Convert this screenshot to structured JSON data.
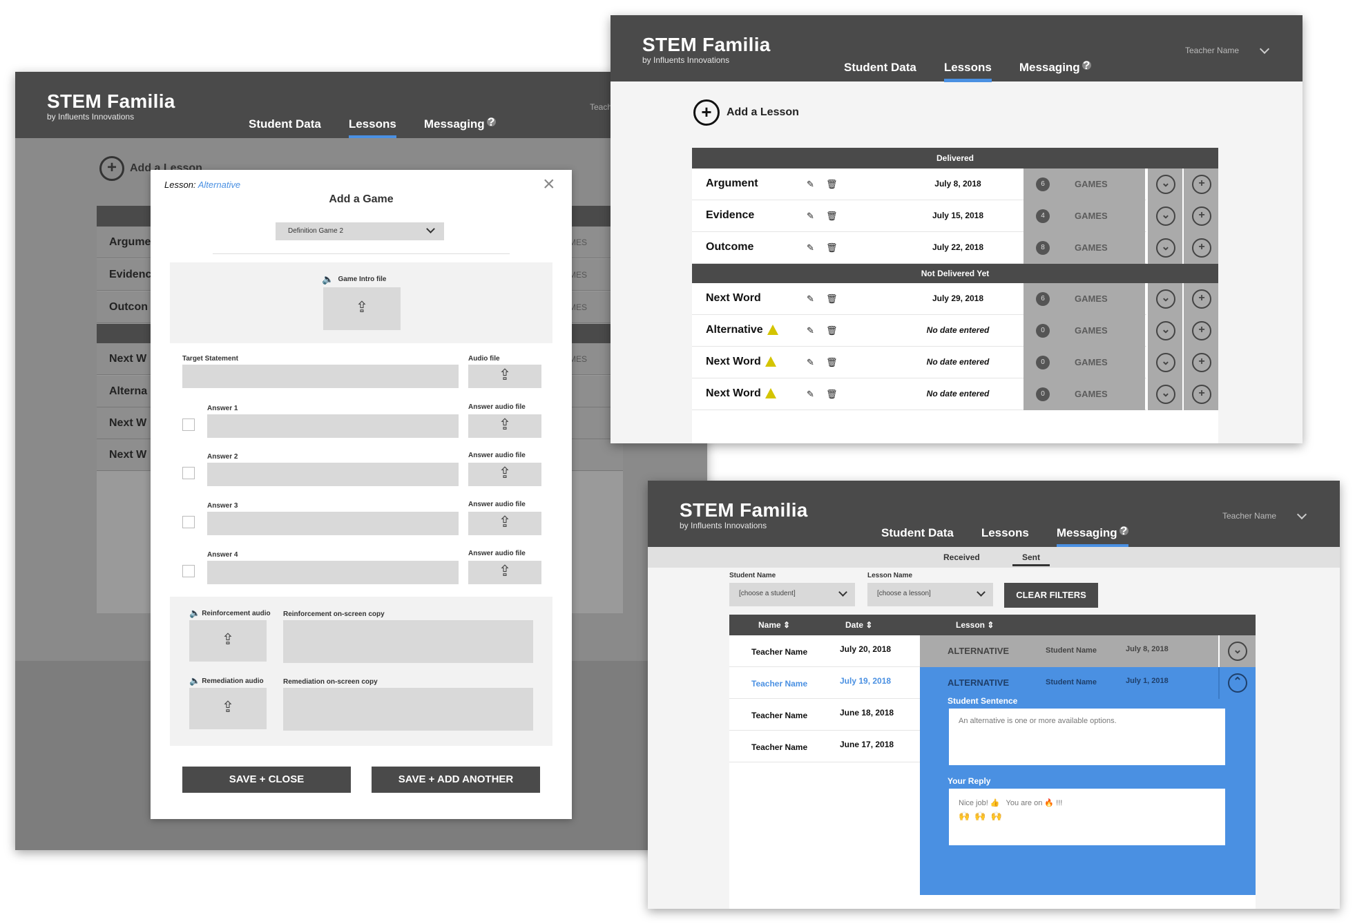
{
  "colors": {
    "header": "#4a4a4a",
    "accent": "#4a90e2",
    "warning": "#d4c400",
    "panel": "#aaaaaa"
  },
  "app": {
    "title": "STEM Familia",
    "subtitle": "by Influents Innovations",
    "teacher": "Teacher Name",
    "teacher_short": "Teach"
  },
  "nav": {
    "student_data": "Student Data",
    "lessons": "Lessons",
    "messaging": "Messaging",
    "help": "?"
  },
  "lessons_screen": {
    "add_lesson": "Add a Lesson",
    "sections": {
      "delivered": "Delivered",
      "not_delivered": "Not Delivered Yet"
    },
    "games_label": "GAMES",
    "delivered": [
      {
        "name": "Argument",
        "date": "July 8, 2018",
        "games": "6"
      },
      {
        "name": "Evidence",
        "date": "July 15, 2018",
        "games": "4"
      },
      {
        "name": "Outcome",
        "date": "July 22, 2018",
        "games": "8"
      }
    ],
    "not_delivered": [
      {
        "name": "Next Word",
        "date": "July 29, 2018",
        "games": "6"
      },
      {
        "name": "Alternative",
        "date": "No date entered",
        "games": "0"
      },
      {
        "name": "Next Word",
        "date": "No date entered",
        "games": "0"
      },
      {
        "name": "Next Word",
        "date": "No date entered",
        "games": "0"
      }
    ]
  },
  "background_screen": {
    "add_lesson": "Add a Lesson",
    "rows": [
      "Argume",
      "Evidenc",
      "Outcon",
      "Next W",
      "Alterna",
      "Next W",
      "Next W"
    ],
    "games_partial": "AMES"
  },
  "modal": {
    "lesson_label": "Lesson:",
    "lesson_name": "Alternative",
    "title": "Add a Game",
    "game_select": "Definition Game 2",
    "game_intro": "Game Intro file",
    "target_statement": "Target Statement",
    "audio_file": "Audio file",
    "answers": [
      {
        "label": "Answer 1",
        "audio": "Answer audio file"
      },
      {
        "label": "Answer 2",
        "audio": "Answer audio file"
      },
      {
        "label": "Answer 3",
        "audio": "Answer audio file"
      },
      {
        "label": "Answer 4",
        "audio": "Answer audio file"
      }
    ],
    "reinforcement_audio": "Reinforcement audio",
    "reinforcement_copy": "Reinforcement on-screen copy",
    "remediation_audio": "Remediation audio",
    "remediation_copy": "Remediation on-screen copy",
    "save_close": "SAVE + CLOSE",
    "save_add": "SAVE + ADD ANOTHER",
    "close": "×"
  },
  "messaging_screen": {
    "tabs": {
      "received": "Received",
      "sent": "Sent"
    },
    "filters": {
      "student_label": "Student Name",
      "student_placeholder": "[choose a student]",
      "lesson_label": "Lesson Name",
      "lesson_placeholder": "[choose a lesson]",
      "clear": "CLEAR FILTERS"
    },
    "columns": {
      "name": "Name",
      "date": "Date",
      "lesson": "Lesson"
    },
    "rows": [
      {
        "name": "Teacher Name",
        "date": "July 20, 2018"
      },
      {
        "name": "Teacher Name",
        "date": "July 19, 2018"
      },
      {
        "name": "Teacher Name",
        "date": "June 18, 2018"
      },
      {
        "name": "Teacher Name",
        "date": "June 17, 2018"
      }
    ],
    "detail": [
      {
        "lesson": "ALTERNATIVE",
        "student": "Student Name",
        "date": "July 8, 2018"
      },
      {
        "lesson": "ALTERNATIVE",
        "student": "Student Name",
        "date": "July 1, 2018"
      }
    ],
    "student_sentence_label": "Student Sentence",
    "student_sentence": "An alternative is one or more available options.",
    "reply_label": "Your Reply",
    "reply_line1": "Nice job! 👍   You are on 🔥 !!!",
    "reply_line2": "🙌  🙌  🙌"
  }
}
